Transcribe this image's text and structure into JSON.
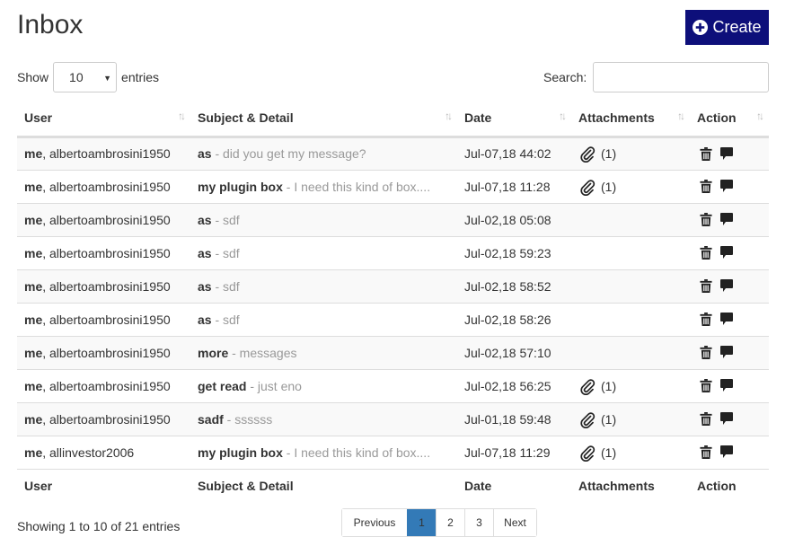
{
  "page": {
    "title": "Inbox"
  },
  "create_button": {
    "label": "Create"
  },
  "length": {
    "show_label": "Show",
    "value": "10",
    "entries_label": "entries"
  },
  "search": {
    "label": "Search:",
    "value": ""
  },
  "columns": [
    "User",
    "Subject & Detail",
    "Date",
    "Attachments",
    "Action"
  ],
  "rows": [
    {
      "user_bold": "me",
      "user_rest": ", albertoambrosini1950",
      "subject": "as",
      "detail": " - did you get my message?",
      "date": "Jul-07,18 44:02",
      "attachments": "(1)"
    },
    {
      "user_bold": "me",
      "user_rest": ", albertoambrosini1950",
      "subject": "my plugin box",
      "detail": " - I need this kind of box....",
      "date": "Jul-07,18 11:28",
      "attachments": "(1)"
    },
    {
      "user_bold": "me",
      "user_rest": ", albertoambrosini1950",
      "subject": "as",
      "detail": " - sdf",
      "date": "Jul-02,18 05:08",
      "attachments": ""
    },
    {
      "user_bold": "me",
      "user_rest": ", albertoambrosini1950",
      "subject": "as",
      "detail": " - sdf",
      "date": "Jul-02,18 59:23",
      "attachments": ""
    },
    {
      "user_bold": "me",
      "user_rest": ", albertoambrosini1950",
      "subject": "as",
      "detail": " - sdf",
      "date": "Jul-02,18 58:52",
      "attachments": ""
    },
    {
      "user_bold": "me",
      "user_rest": ", albertoambrosini1950",
      "subject": "as",
      "detail": " - sdf",
      "date": "Jul-02,18 58:26",
      "attachments": ""
    },
    {
      "user_bold": "me",
      "user_rest": ", albertoambrosini1950",
      "subject": "more",
      "detail": " - messages",
      "date": "Jul-02,18 57:10",
      "attachments": ""
    },
    {
      "user_bold": "me",
      "user_rest": ", albertoambrosini1950",
      "subject": "get read",
      "detail": " - just eno",
      "date": "Jul-02,18 56:25",
      "attachments": "(1)"
    },
    {
      "user_bold": "me",
      "user_rest": ", albertoambrosini1950",
      "subject": "sadf",
      "detail": " - ssssss",
      "date": "Jul-01,18 59:48",
      "attachments": "(1)"
    },
    {
      "user_bold": "me",
      "user_rest": ", allinvestor2006",
      "subject": "my plugin box",
      "detail": " - I need this kind of box....",
      "date": "Jul-07,18 11:29",
      "attachments": "(1)"
    }
  ],
  "footer": {
    "info": "Showing 1 to 10 of 21 entries"
  },
  "pagination": {
    "previous": "Previous",
    "pages": [
      "1",
      "2",
      "3"
    ],
    "active": "1",
    "next": "Next"
  },
  "colors": {
    "create_bg": "#0d0f7a",
    "active_page": "#337ab7",
    "detail_text": "#999999"
  },
  "icons": {
    "create": "plus-circle-icon",
    "attachment": "paperclip-icon",
    "delete": "trash-icon",
    "reply": "comment-icon",
    "sort": "sort-arrows-icon"
  }
}
